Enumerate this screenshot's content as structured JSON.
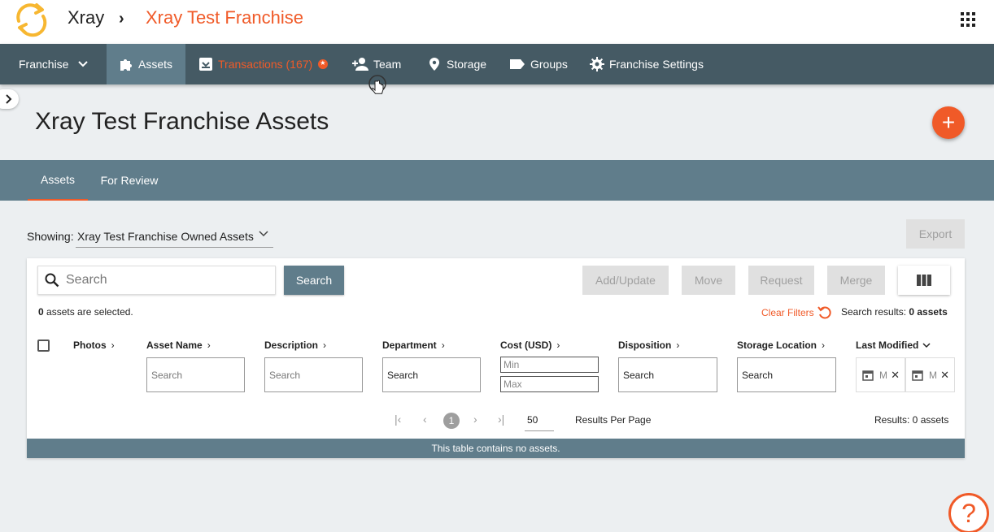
{
  "header": {
    "app_name": "Xray",
    "breadcrumb_separator": "›",
    "franchise_title": "Xray Test Franchise",
    "brand_color": "#f05a28"
  },
  "nav": {
    "franchise_menu": "Franchise",
    "assets": "Assets",
    "transactions": "Transactions (167)",
    "team": "Team",
    "storage": "Storage",
    "groups": "Groups",
    "franchise_settings": "Franchise Settings"
  },
  "page": {
    "title": "Xray Test Franchise Assets",
    "add_button": "+"
  },
  "subtabs": {
    "assets": "Assets",
    "for_review": "For Review"
  },
  "showing": {
    "label": "Showing:",
    "selected": "Xray Test Franchise Owned Assets",
    "export": "Export"
  },
  "toolbar": {
    "search_placeholder": "Search",
    "search_button": "Search",
    "add_update": "Add/Update",
    "move": "Move",
    "request": "Request",
    "merge": "Merge"
  },
  "status": {
    "selected_count": "0",
    "selected_suffix": " assets are selected.",
    "clear_filters": "Clear Filters",
    "search_results_label": "Search results: ",
    "search_results_value": "0 assets"
  },
  "columns": {
    "photos": "Photos",
    "asset_name": "Asset Name",
    "description": "Description",
    "department": "Department",
    "cost": "Cost (USD)",
    "disposition": "Disposition",
    "storage_location": "Storage Location",
    "last_modified": "Last Modified"
  },
  "filters": {
    "search_placeholder": "Search",
    "min_placeholder": "Min",
    "max_placeholder": "Max",
    "date_placeholder": "M"
  },
  "pagination": {
    "first": "|‹",
    "prev": "‹",
    "current_page": "1",
    "next": "›",
    "last": "›|",
    "per_page": "50",
    "per_page_label": "Results Per Page",
    "results": "Results: 0 assets"
  },
  "empty_message": "This table contains no assets.",
  "help": "?"
}
